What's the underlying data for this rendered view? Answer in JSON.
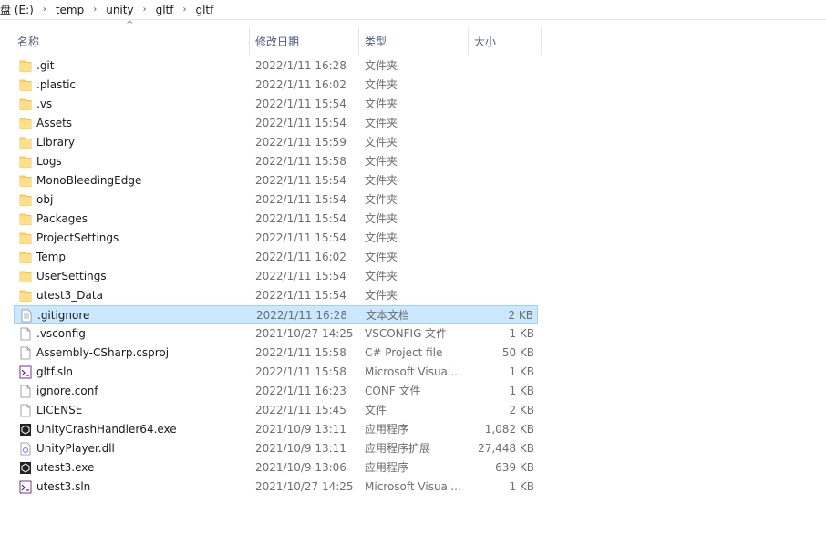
{
  "breadcrumb": [
    "盘 (E:)",
    "temp",
    "unity",
    "gltf",
    "gltf"
  ],
  "columns": {
    "name": "名称",
    "date": "修改日期",
    "type": "类型",
    "size": "大小"
  },
  "sort_indicator": "^",
  "files": [
    {
      "name": ".git",
      "date": "2022/1/11 16:28",
      "type": "文件夹",
      "size": "",
      "icon": "folder-icon"
    },
    {
      "name": ".plastic",
      "date": "2022/1/11 16:02",
      "type": "文件夹",
      "size": "",
      "icon": "folder-icon"
    },
    {
      "name": ".vs",
      "date": "2022/1/11 15:54",
      "type": "文件夹",
      "size": "",
      "icon": "folder-icon"
    },
    {
      "name": "Assets",
      "date": "2022/1/11 15:54",
      "type": "文件夹",
      "size": "",
      "icon": "folder-icon"
    },
    {
      "name": "Library",
      "date": "2022/1/11 15:59",
      "type": "文件夹",
      "size": "",
      "icon": "folder-icon"
    },
    {
      "name": "Logs",
      "date": "2022/1/11 15:58",
      "type": "文件夹",
      "size": "",
      "icon": "folder-icon"
    },
    {
      "name": "MonoBleedingEdge",
      "date": "2022/1/11 15:54",
      "type": "文件夹",
      "size": "",
      "icon": "folder-icon"
    },
    {
      "name": "obj",
      "date": "2022/1/11 15:54",
      "type": "文件夹",
      "size": "",
      "icon": "folder-icon"
    },
    {
      "name": "Packages",
      "date": "2022/1/11 15:54",
      "type": "文件夹",
      "size": "",
      "icon": "folder-icon"
    },
    {
      "name": "ProjectSettings",
      "date": "2022/1/11 15:54",
      "type": "文件夹",
      "size": "",
      "icon": "folder-icon"
    },
    {
      "name": "Temp",
      "date": "2022/1/11 16:02",
      "type": "文件夹",
      "size": "",
      "icon": "folder-icon"
    },
    {
      "name": "UserSettings",
      "date": "2022/1/11 15:54",
      "type": "文件夹",
      "size": "",
      "icon": "folder-icon"
    },
    {
      "name": "utest3_Data",
      "date": "2022/1/11 15:54",
      "type": "文件夹",
      "size": "",
      "icon": "folder-icon"
    },
    {
      "name": ".gitignore",
      "date": "2022/1/11 16:28",
      "type": "文本文档",
      "size": "2 KB",
      "icon": "text-file-icon",
      "selected": true
    },
    {
      "name": ".vsconfig",
      "date": "2021/10/27 14:25",
      "type": "VSCONFIG 文件",
      "size": "1 KB",
      "icon": "file-icon"
    },
    {
      "name": "Assembly-CSharp.csproj",
      "date": "2022/1/11 15:58",
      "type": "C# Project file",
      "size": "50 KB",
      "icon": "file-icon"
    },
    {
      "name": "gltf.sln",
      "date": "2022/1/11 15:58",
      "type": "Microsoft Visual...",
      "size": "1 KB",
      "icon": "vs-solution-icon"
    },
    {
      "name": "ignore.conf",
      "date": "2022/1/11 16:23",
      "type": "CONF 文件",
      "size": "1 KB",
      "icon": "file-icon"
    },
    {
      "name": "LICENSE",
      "date": "2022/1/11 15:45",
      "type": "文件",
      "size": "2 KB",
      "icon": "file-icon"
    },
    {
      "name": "UnityCrashHandler64.exe",
      "date": "2021/10/9 13:11",
      "type": "应用程序",
      "size": "1,082 KB",
      "icon": "unity-exe-icon"
    },
    {
      "name": "UnityPlayer.dll",
      "date": "2021/10/9 13:11",
      "type": "应用程序扩展",
      "size": "27,448 KB",
      "icon": "dll-icon"
    },
    {
      "name": "utest3.exe",
      "date": "2021/10/9 13:06",
      "type": "应用程序",
      "size": "639 KB",
      "icon": "unity-exe-icon"
    },
    {
      "name": "utest3.sln",
      "date": "2021/10/27 14:25",
      "type": "Microsoft Visual...",
      "size": "1 KB",
      "icon": "vs-solution-icon"
    }
  ]
}
